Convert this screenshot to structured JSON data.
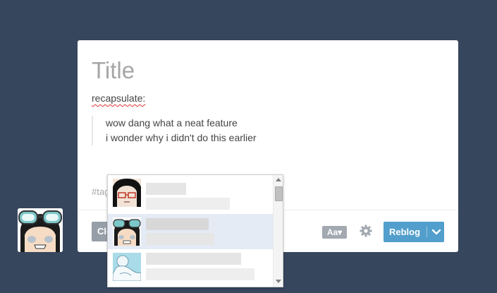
{
  "post": {
    "title_placeholder": "Title",
    "intro_text": "recapsulate:",
    "quote_lines": [
      "wow dang what a neat feature",
      "i wonder why i didn't do this earlier"
    ],
    "tags_placeholder": "#tags"
  },
  "footer": {
    "close_label": "Close",
    "format_label": "Aa▾",
    "reblog_label": "Reblog",
    "settings_icon": "gear-icon",
    "dropdown_icon": "chevron-down-icon"
  },
  "mention_dropdown": {
    "items": [
      {
        "avatar": "avatar-red-glasses",
        "highlighted": false
      },
      {
        "avatar": "avatar-goggles",
        "highlighted": true
      },
      {
        "avatar": "avatar-sketch",
        "highlighted": false
      }
    ]
  },
  "colors": {
    "background": "#36465d",
    "accent": "#529ecc",
    "close_button": "#969fa8",
    "highlight_row": "#e4ebf5"
  }
}
